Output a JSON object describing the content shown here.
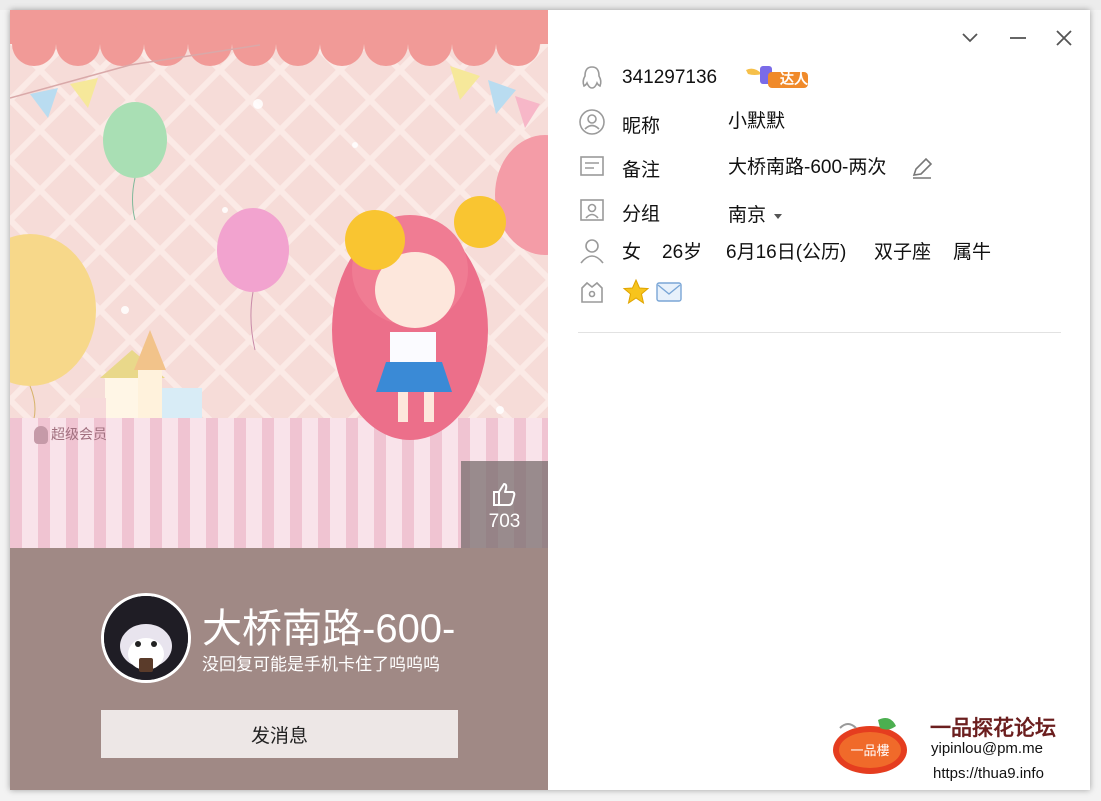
{
  "window": {
    "controls": [
      "dropdown",
      "minimize",
      "close"
    ]
  },
  "cover": {
    "vip_badge": "超级会员",
    "likes": "703"
  },
  "profile": {
    "display_name": "大桥南路-600-",
    "signature": "没回复可能是手机卡住了呜呜呜",
    "send_message_label": "发消息"
  },
  "info": {
    "qq_number": "341297136",
    "talent_badge": "达人",
    "nickname_label": "昵称",
    "nickname": "小默默",
    "remark_label": "备注",
    "remark": "大桥南路-600-两次",
    "group_label": "分组",
    "group": "南京",
    "gender": "女",
    "age": "26岁",
    "birthday": "6月16日(公历)",
    "zodiac": "双子座",
    "chinese_zodiac": "属牛"
  },
  "watermark": {
    "logo_text": "一品樓",
    "title": "一品探花论坛",
    "email": "yipinlou@pm.me",
    "url": "https://thua9.info"
  },
  "colors": {
    "profile_bg": "#a08985",
    "cover_bg": "#f6dcd8",
    "button_bg": "#ede7e6"
  }
}
